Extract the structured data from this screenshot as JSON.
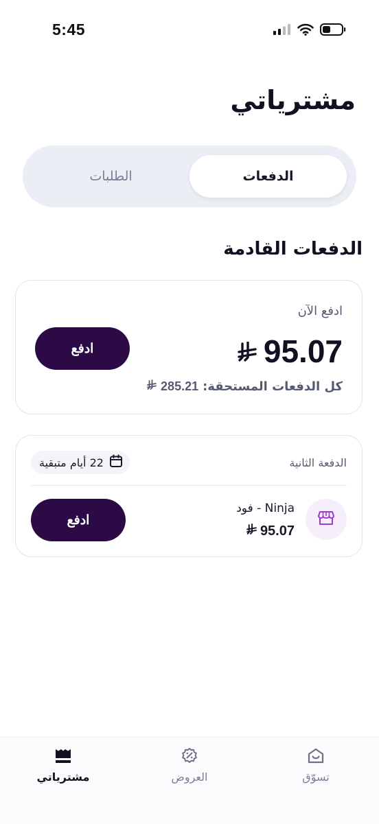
{
  "status_bar": {
    "time": "5:45"
  },
  "page": {
    "title": "مشترياتي"
  },
  "tabs": {
    "active": "الدفعات",
    "inactive": "الطلبات"
  },
  "upcoming": {
    "section_title": "الدفعات القادمة",
    "pay_now_label": "ادفع الآن",
    "pay_now_amount": "95.07",
    "total_due_label": "كل الدفعات المستحقة:",
    "total_due_amount": "285.21",
    "pay_button": "ادفع"
  },
  "second_payment": {
    "label": "الدفعة الثانية",
    "days_remaining": "22 أيام متبقية",
    "merchant": "Ninja - فود",
    "amount": "95.07",
    "pay_button": "ادفع"
  },
  "bottom_nav": {
    "items": [
      {
        "label": "مشترياتي",
        "icon": "receipt-icon",
        "active": true
      },
      {
        "label": "العروض",
        "icon": "discount-badge-icon",
        "active": false
      },
      {
        "label": "تسوّق",
        "icon": "shop-home-icon",
        "active": false
      }
    ]
  },
  "colors": {
    "primary_button": "#2b0a45",
    "segmented_bg": "#eceef5",
    "muted_text": "#7a7d98",
    "store_avatar_bg": "#f7eefb",
    "store_icon": "#9b3bd0"
  }
}
